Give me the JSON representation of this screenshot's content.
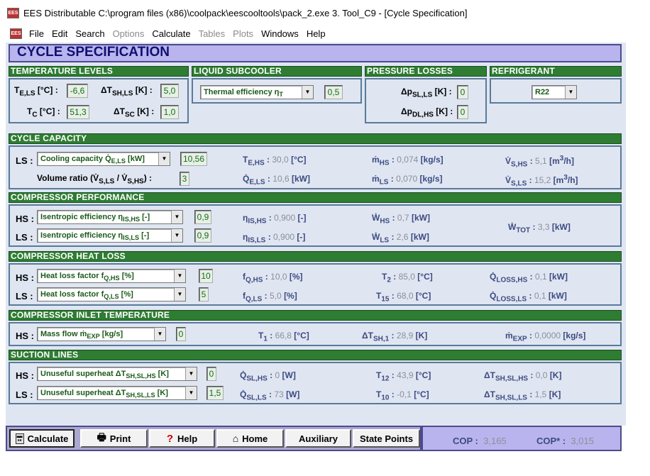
{
  "window": {
    "title": "EES Distributable  C:\\program files (x86)\\coolpack\\eescooltools\\pack_2.exe   3. Tool_C9 - [Cycle Specification]",
    "icon": "ees-icon"
  },
  "menu": [
    {
      "label": "File",
      "enabled": true
    },
    {
      "label": "Edit",
      "enabled": true
    },
    {
      "label": "Search",
      "enabled": true
    },
    {
      "label": "Options",
      "enabled": false
    },
    {
      "label": "Calculate",
      "enabled": true
    },
    {
      "label": "Tables",
      "enabled": false
    },
    {
      "label": "Plots",
      "enabled": false
    },
    {
      "label": "Windows",
      "enabled": true
    },
    {
      "label": "Help",
      "enabled": true
    }
  ],
  "header": "CYCLE SPECIFICATION",
  "temperature_levels": {
    "title": "TEMPERATURE LEVELS",
    "te_ls_label": "T<sub>E,LS</sub> [°C] :",
    "te_ls": "-6,6",
    "dtsh_ls_label": "ΔT<sub>SH,LS</sub> [K] :",
    "dtsh_ls": "5,0",
    "tc_label": "T<sub>C</sub> [°C] :",
    "tc": "51,3",
    "dtsc_label": "ΔT<sub>SC</sub> [K] :",
    "dtsc": "1,0"
  },
  "liquid_subcooler": {
    "title": "LIQUID SUBCOOLER",
    "mode": "Thermal efficiency η<sub>T</sub>",
    "value": "0,5"
  },
  "pressure_losses": {
    "title": "PRESSURE LOSSES",
    "dp_sl_label": "Δp<sub>SL,LS</sub> [K] :",
    "dp_sl": "0",
    "dp_dl_label": "Δp<sub>DL,HS</sub> [K] :",
    "dp_dl": "0"
  },
  "refrigerant": {
    "title": "REFRIGERANT",
    "value": "R22"
  },
  "cycle_capacity": {
    "title": "CYCLE CAPACITY",
    "ls_label": "LS :",
    "ls_mode": "Cooling capacity Q̇<sub>E,LS</sub> [kW]",
    "ls_value": "10,56",
    "vol_ratio_label": "Volume ratio (V̇<sub>S,LS</sub> / V̇<sub>S,HS</sub>) :",
    "vol_ratio": "3",
    "te_hs_label": "T<sub>E,HS</sub> :",
    "te_hs": "30,0",
    "te_hs_unit": "[°C]",
    "qe_ls_label": "Q̇<sub>E,LS</sub> :",
    "qe_ls": "10,6",
    "qe_ls_unit": "[kW]",
    "m_hs_label": "ṁ<sub>HS</sub> :",
    "m_hs": "0,074",
    "m_hs_unit": "[kg/s]",
    "m_ls_label": "ṁ<sub>LS</sub> :",
    "m_ls": "0,070",
    "m_ls_unit": "[kg/s]",
    "vs_hs_label": "V̇<sub>S,HS</sub> :",
    "vs_hs": "5,1",
    "vs_hs_unit": "[m<sup>3</sup>/h]",
    "vs_ls_label": "V̇<sub>S,LS</sub> :",
    "vs_ls": "15,2",
    "vs_ls_unit": "[m<sup>3</sup>/h]"
  },
  "compressor_performance": {
    "title": "COMPRESSOR PERFORMANCE",
    "hs_label": "HS :",
    "hs_mode": "Isentropic efficiency η<sub>IS,HS</sub> [-]",
    "hs_value": "0,9",
    "ls_label": "LS :",
    "ls_mode": "Isentropic efficiency η<sub>IS,LS</sub> [-]",
    "ls_value": "0,9",
    "eta_hs_label": "η<sub>IS,HS</sub> :",
    "eta_hs": "0,900",
    "eta_hs_unit": "[-]",
    "eta_ls_label": "η<sub>IS,LS</sub> :",
    "eta_ls": "0,900",
    "eta_ls_unit": "[-]",
    "w_hs_label": "Ẇ<sub>HS</sub> :",
    "w_hs": "0,7",
    "w_hs_unit": "[kW]",
    "w_ls_label": "Ẇ<sub>LS</sub> :",
    "w_ls": "2,6",
    "w_ls_unit": "[kW]",
    "w_tot_label": "Ẇ<sub>TOT</sub> :",
    "w_tot": "3,3",
    "w_tot_unit": "[kW]"
  },
  "compressor_heat_loss": {
    "title": "COMPRESSOR HEAT LOSS",
    "hs_label": "HS :",
    "hs_mode": "Heat loss factor f<sub>Q,HS</sub> [%]",
    "hs_value": "10",
    "ls_label": "LS :",
    "ls_mode": "Heat loss factor f<sub>Q,LS</sub> [%]",
    "ls_value": "5",
    "fq_hs_label": "f<sub>Q,HS</sub> :",
    "fq_hs": "10,0",
    "fq_hs_unit": "[%]",
    "fq_ls_label": "f<sub>Q,LS</sub> :",
    "fq_ls": "5,0",
    "fq_ls_unit": "[%]",
    "t2_label": "T<sub>2</sub> :",
    "t2": "85,0",
    "t2_unit": "[°C]",
    "t15_label": "T<sub>15</sub> :",
    "t15": "68,0",
    "t15_unit": "[°C]",
    "qloss_hs_label": "Q̇<sub>LOSS,HS</sub> :",
    "qloss_hs": "0,1",
    "qloss_hs_unit": "[kW]",
    "qloss_ls_label": "Q̇<sub>LOSS,LS</sub> :",
    "qloss_ls": "0,1",
    "qloss_ls_unit": "[kW]"
  },
  "compressor_inlet_temperature": {
    "title": "COMPRESSOR INLET TEMPERATURE",
    "hs_label": "HS :",
    "hs_mode": "Mass flow ṁ<sub>EXP</sub> [kg/s]",
    "hs_value": "0",
    "t1_label": "T<sub>1</sub> :",
    "t1": "66,8",
    "t1_unit": "[°C]",
    "dtsh1_label": "ΔT<sub>SH,1</sub> :",
    "dtsh1": "28,9",
    "dtsh1_unit": "[K]",
    "mexp_label": "ṁ<sub>EXP</sub> :",
    "mexp": "0,0000",
    "mexp_unit": "[kg/s]"
  },
  "suction_lines": {
    "title": "SUCTION LINES",
    "hs_label": "HS :",
    "hs_mode": "Unuseful superheat ΔT<sub>SH,SL,HS</sub> [K]",
    "hs_value": "0",
    "ls_label": "LS :",
    "ls_mode": "Unuseful superheat ΔT<sub>SH,SL,LS</sub> [K]",
    "ls_value": "1,5",
    "qsl_hs_label": "Q̇<sub>SL,HS</sub> :",
    "qsl_hs": "0",
    "qsl_hs_unit": "[W]",
    "qsl_ls_label": "Q̇<sub>SL,LS</sub> :",
    "qsl_ls": "73",
    "qsl_ls_unit": "[W]",
    "t12_label": "T<sub>12</sub> :",
    "t12": "43,9",
    "t12_unit": "[°C]",
    "t10_label": "T<sub>10</sub> :",
    "t10": "-0,1",
    "t10_unit": "[°C]",
    "dtsl_hs_label": "ΔT<sub>SH,SL,HS</sub> :",
    "dtsl_hs": "0,0",
    "dtsl_hs_unit": "[K]",
    "dtsl_ls_label": "ΔT<sub>SH,SL,LS</sub> :",
    "dtsl_ls": "1,5",
    "dtsl_ls_unit": "[K]"
  },
  "buttons": {
    "calculate": "Calculate",
    "print": "Print",
    "help": "Help",
    "home": "Home",
    "auxiliary": "Auxiliary",
    "state_points": "State Points"
  },
  "cop": {
    "cop_label": "COP :",
    "cop": "3,165",
    "copstar_label": "COP* :",
    "copstar": "3,015"
  },
  "colors": {
    "section_green": "#2e7d32",
    "header_purple": "#b9b4ee",
    "panel_bg": "#dfe6f2",
    "input_green": "#1a6a1a"
  }
}
